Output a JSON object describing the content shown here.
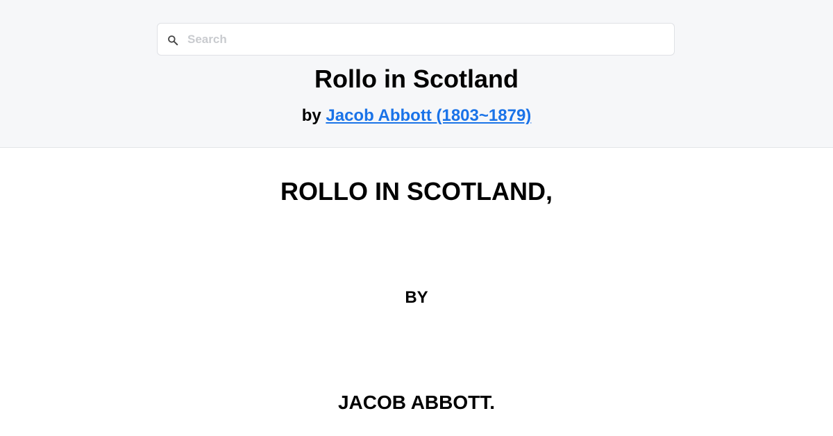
{
  "search": {
    "placeholder": "Search",
    "value": ""
  },
  "header": {
    "title": "Rollo in Scotland",
    "by_prefix": "by",
    "author_link": "Jacob Abbott (1803~1879)"
  },
  "content": {
    "main_title": "ROLLO IN SCOTLAND,",
    "by_label": "BY",
    "author_name": "JACOB ABBOTT."
  },
  "colors": {
    "header_bg": "#f6f7f9",
    "link": "#1a73e8",
    "placeholder": "#c9cbcf"
  },
  "icons": {
    "search": "search-icon"
  }
}
